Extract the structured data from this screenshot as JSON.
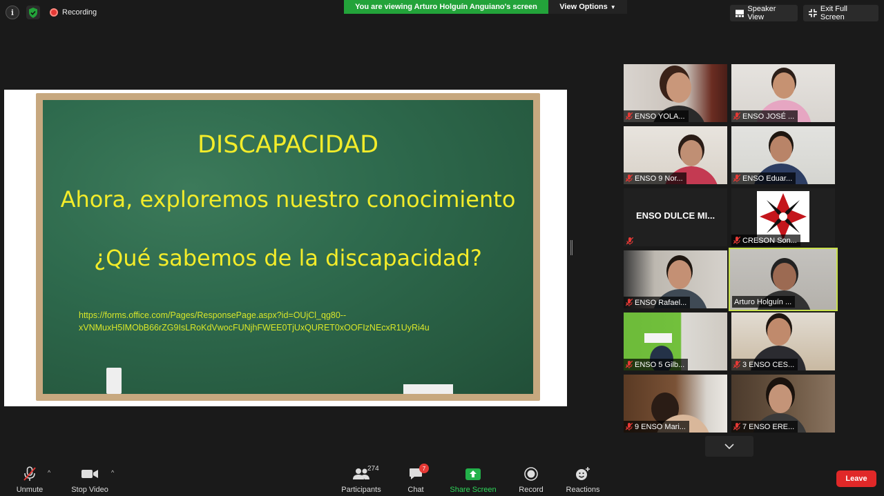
{
  "topbar": {
    "recording_label": "Recording",
    "viewing_banner": "You are viewing Arturo Holguín Anguiano's screen",
    "view_options_label": "View Options",
    "speaker_view_label": "Speaker View",
    "exit_fullscreen_label": "Exit Full Screen"
  },
  "slide": {
    "title": "DISCAPACIDAD",
    "subtitle1": "Ahora, exploremos nuestro conocimiento",
    "subtitle2": "¿Qué sabemos de la discapacidad?",
    "link_line1": "https://forms.office.com/Pages/ResponsePage.aspx?id=OUjCl_qg80--",
    "link_line2": "xVNMuxH5IMObB66rZG9IsLRoKdVwocFUNjhFWEE0TjUxQURET0xOOFIzNEcxR1UyRi4u"
  },
  "participants": [
    {
      "name": "ENSO YOLA..."
    },
    {
      "name": "ENSO JOSÉ ..."
    },
    {
      "name": "ENSO 9 Nor..."
    },
    {
      "name": "ENSO Eduar..."
    },
    {
      "name": "ENSO DULCE MI..."
    },
    {
      "name": "CRESON Son..."
    },
    {
      "name": "ENSO Rafael..."
    },
    {
      "name": "Arturo Holguín ..."
    },
    {
      "name": "ENSO 5 Gilb..."
    },
    {
      "name": "3 ENSO CES..."
    },
    {
      "name": "9 ENSO Mari..."
    },
    {
      "name": "7 ENSO ERE..."
    }
  ],
  "toolbar": {
    "unmute_label": "Unmute",
    "stop_video_label": "Stop Video",
    "participants_label": "Participants",
    "participants_count": "274",
    "chat_label": "Chat",
    "chat_badge": "7",
    "share_screen_label": "Share Screen",
    "record_label": "Record",
    "reactions_label": "Reactions",
    "leave_label": "Leave"
  },
  "colors": {
    "share_green": "#23a33a",
    "leave_red": "#e02828",
    "active_speaker": "#c9e04c",
    "slide_text": "#f3ec2a"
  }
}
